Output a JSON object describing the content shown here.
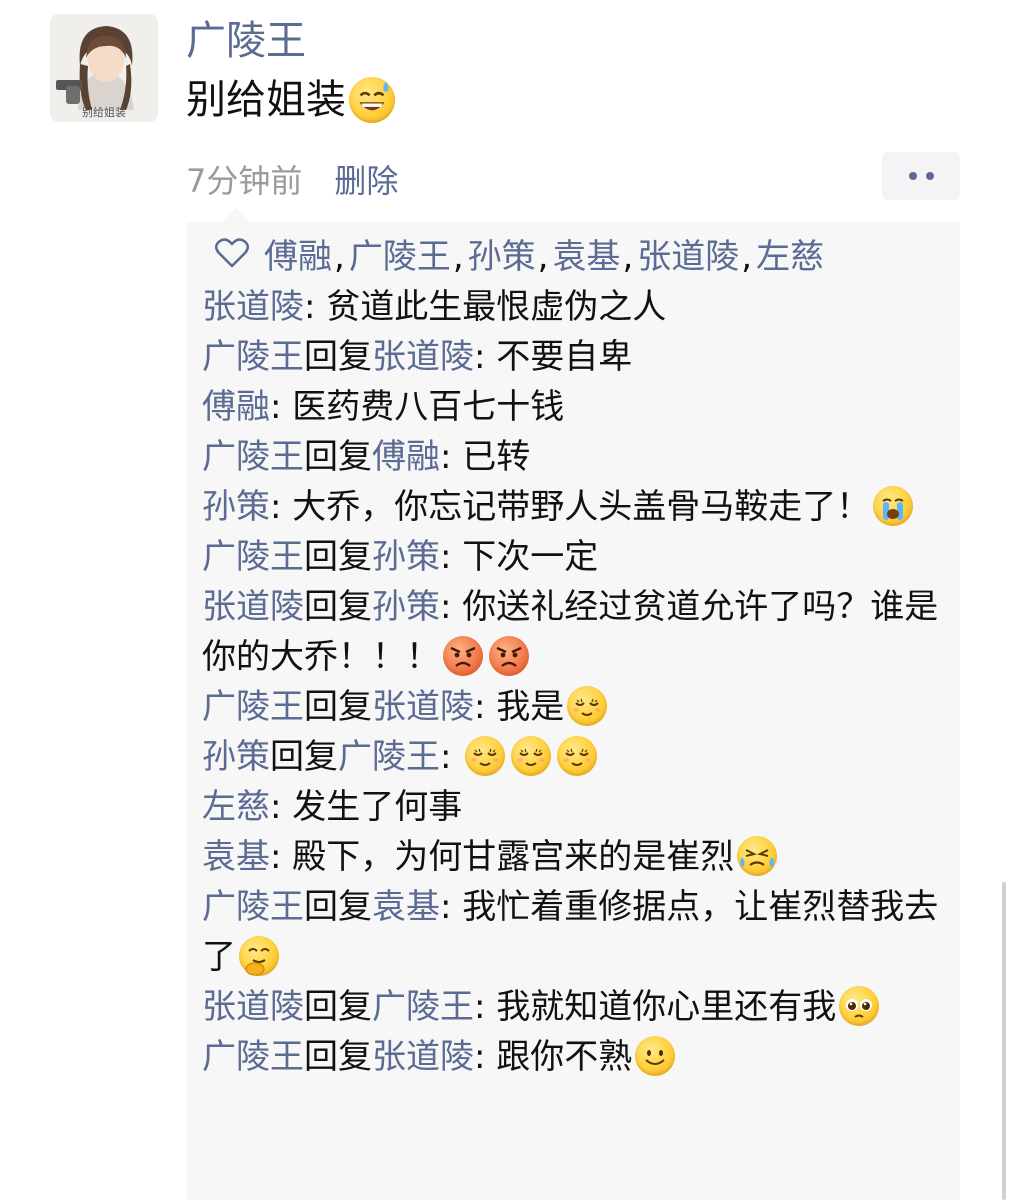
{
  "post": {
    "author": "广陵王",
    "text": "别给姐装",
    "text_emoji": "sweat-smile-emoji",
    "avatar_caption": "别给姐装",
    "time": "7分钟前",
    "delete_label": "删除"
  },
  "likes": {
    "names": [
      "傅融",
      "广陵王",
      "孙策",
      "袁基",
      "张道陵",
      "左慈"
    ],
    "separator": ","
  },
  "reply_word": "回复",
  "colon": ": ",
  "comments": [
    {
      "author": "张道陵",
      "reply_to": null,
      "text": "贫道此生最恨虚伪之人",
      "emojis": []
    },
    {
      "author": "广陵王",
      "reply_to": "张道陵",
      "text": "不要自卑",
      "emojis": []
    },
    {
      "author": "傅融",
      "reply_to": null,
      "text": "医药费八百七十钱",
      "emojis": []
    },
    {
      "author": "广陵王",
      "reply_to": "傅融",
      "text": "已转",
      "emojis": []
    },
    {
      "author": "孙策",
      "reply_to": null,
      "text": "大乔，你忘记带野人头盖骨马鞍走了！",
      "emojis": [
        "crying-emoji"
      ]
    },
    {
      "author": "广陵王",
      "reply_to": "孙策",
      "text": "下次一定",
      "emojis": []
    },
    {
      "author": "张道陵",
      "reply_to": "孙策",
      "text": "你送礼经过贫道允许了吗？谁是你的大乔！！！",
      "emojis": [
        "angry-emoji",
        "angry-emoji"
      ]
    },
    {
      "author": "广陵王",
      "reply_to": "张道陵",
      "text": "我是",
      "emojis": [
        "smug-emoji"
      ]
    },
    {
      "author": "孙策",
      "reply_to": "广陵王",
      "text": "",
      "emojis": [
        "smug-emoji",
        "smug-emoji",
        "smug-emoji"
      ]
    },
    {
      "author": "左慈",
      "reply_to": null,
      "text": "发生了何事",
      "emojis": []
    },
    {
      "author": "袁基",
      "reply_to": null,
      "text": "殿下，为何甘露宫来的是崔烈",
      "emojis": [
        "tears-of-frustration-emoji"
      ]
    },
    {
      "author": "广陵王",
      "reply_to": "袁基",
      "text": "我忙着重修据点，让崔烈替我去了",
      "emojis": [
        "giggle-emoji"
      ]
    },
    {
      "author": "张道陵",
      "reply_to": "广陵王",
      "text": "我就知道你心里还有我",
      "emojis": [
        "pleading-emoji"
      ]
    },
    {
      "author": "广陵王",
      "reply_to": "张道陵",
      "text": "跟你不熟",
      "emojis": [
        "smile-emoji"
      ]
    }
  ],
  "colors": {
    "name_link": "#5b6b93",
    "panel_bg": "#f7f7f7",
    "meta_text": "#9b9b9b"
  }
}
